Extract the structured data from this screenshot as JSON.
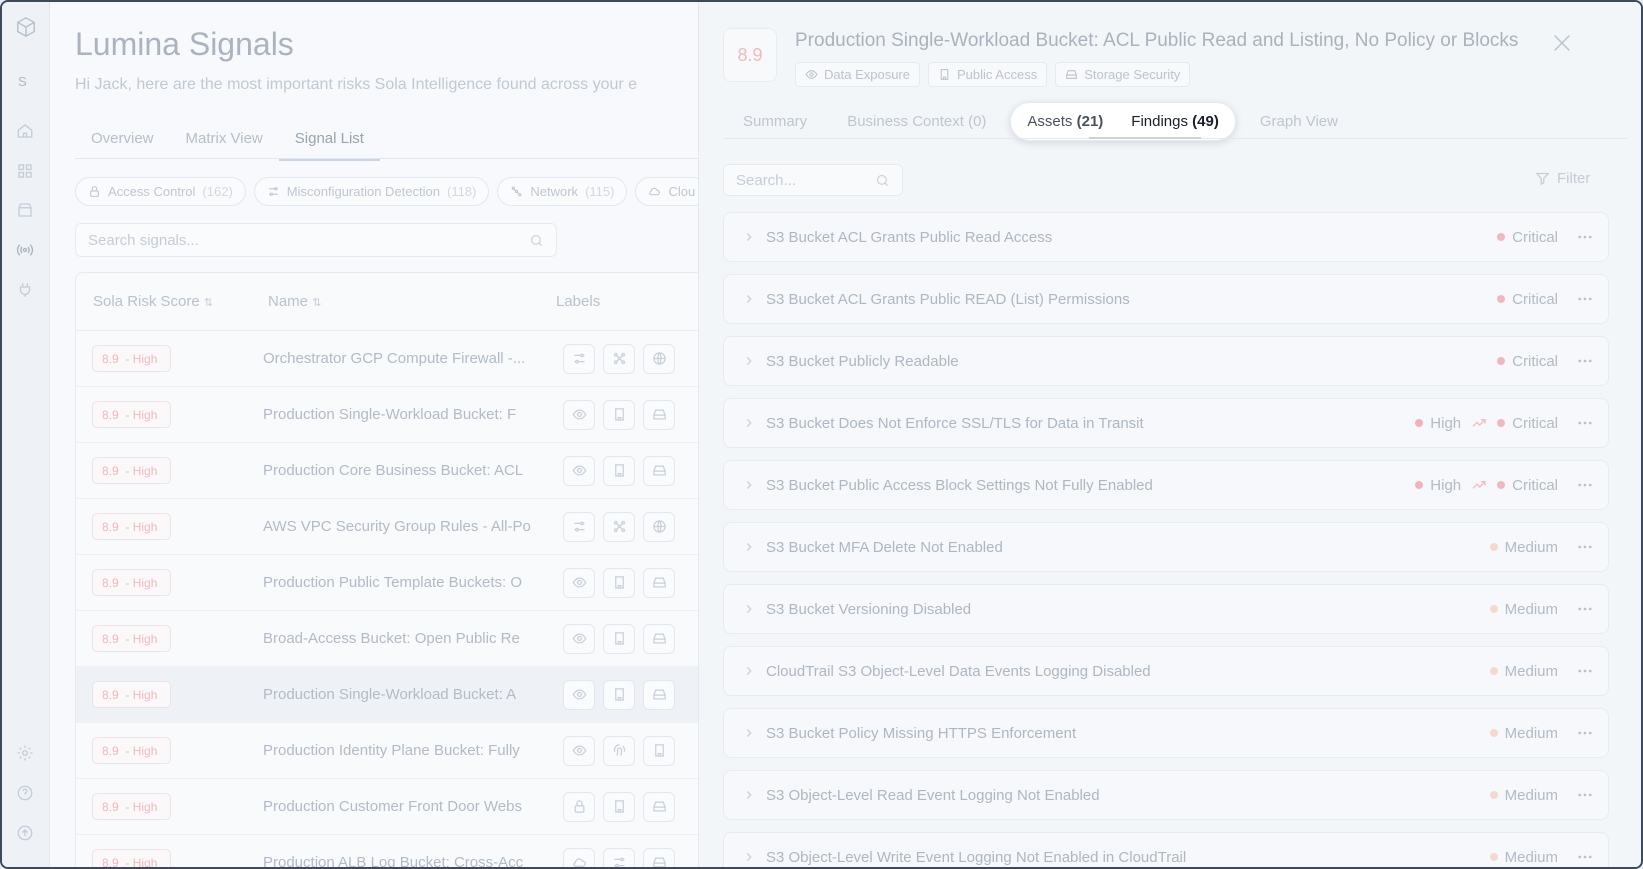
{
  "app": {
    "title": "Lumina Signals",
    "subtitle": "Hi Jack, here are the most important risks Sola Intelligence found across your e"
  },
  "sidebar": {
    "avatar": "S"
  },
  "tabs": [
    {
      "label": "Overview"
    },
    {
      "label": "Matrix View"
    },
    {
      "label": "Signal List"
    }
  ],
  "chips": [
    {
      "label": "Access Control",
      "count": "(162)"
    },
    {
      "label": "Misconfiguration Detection",
      "count": "(118)"
    },
    {
      "label": "Network",
      "count": "(115)"
    },
    {
      "label": "Clou",
      "count": ""
    }
  ],
  "signals_search": {
    "placeholder": "Search signals..."
  },
  "table": {
    "headers": {
      "score": "Sola Risk Score",
      "name": "Name",
      "labels": "Labels"
    },
    "rows": [
      {
        "score": "8.9",
        "level": "- High",
        "name": "Orchestrator GCP Compute Firewall -..."
      },
      {
        "score": "8.9",
        "level": "- High",
        "name": "Production Single-Workload Bucket: F"
      },
      {
        "score": "8.9",
        "level": "- High",
        "name": "Production Core Business Bucket: ACL"
      },
      {
        "score": "8.9",
        "level": "- High",
        "name": "AWS VPC Security Group Rules - All-Po"
      },
      {
        "score": "8.9",
        "level": "- High",
        "name": "Production Public Template Buckets: O"
      },
      {
        "score": "8.9",
        "level": "- High",
        "name": "Broad-Access Bucket: Open Public Re"
      },
      {
        "score": "8.9",
        "level": "- High",
        "name": "Production Single-Workload Bucket: A"
      },
      {
        "score": "8.9",
        "level": "- High",
        "name": "Production Identity Plane Bucket: Fully"
      },
      {
        "score": "8.9",
        "level": "- High",
        "name": "Production Customer Front Door Webs"
      },
      {
        "score": "8.9",
        "level": "- High",
        "name": "Production ALB Log Bucket: Cross-Acc"
      }
    ]
  },
  "panel": {
    "score": "8.9",
    "title": "Production Single-Workload Bucket: ACL Public Read and Listing, No Policy or Blocks",
    "tags": [
      "Data Exposure",
      "Public Access",
      "Storage Security"
    ],
    "tabs": {
      "summary": "Summary",
      "business": "Business Context (0)",
      "assets_label": "Assets",
      "assets_count": "(21)",
      "findings_label": "Findings",
      "findings_count": "(49)",
      "graph": "Graph View"
    },
    "search_placeholder": "Search...",
    "filter": "Filter",
    "colors": {
      "critical": "#f0b8be",
      "high": "#f2b3b8",
      "medium": "#f5d9cf"
    },
    "findings": [
      {
        "title": "S3 Bucket ACL Grants Public Read Access",
        "severity": "Critical"
      },
      {
        "title": "S3 Bucket ACL Grants Public READ (List) Permissions",
        "severity": "Critical"
      },
      {
        "title": "S3 Bucket Publicly Readable",
        "severity": "Critical"
      },
      {
        "title": "S3 Bucket Does Not Enforce SSL/TLS for Data in Transit",
        "severity": "Critical",
        "from": "High"
      },
      {
        "title": "S3 Bucket Public Access Block Settings Not Fully Enabled",
        "severity": "Critical",
        "from": "High"
      },
      {
        "title": "S3 Bucket MFA Delete Not Enabled",
        "severity": "Medium"
      },
      {
        "title": "S3 Bucket Versioning Disabled",
        "severity": "Medium"
      },
      {
        "title": "CloudTrail S3 Object-Level Data Events Logging Disabled",
        "severity": "Medium"
      },
      {
        "title": "S3 Bucket Policy Missing HTTPS Enforcement",
        "severity": "Medium"
      },
      {
        "title": "S3 Object-Level Read Event Logging Not Enabled",
        "severity": "Medium"
      },
      {
        "title": "S3 Object-Level Write Event Logging Not Enabled in CloudTrail",
        "severity": "Medium"
      }
    ]
  }
}
